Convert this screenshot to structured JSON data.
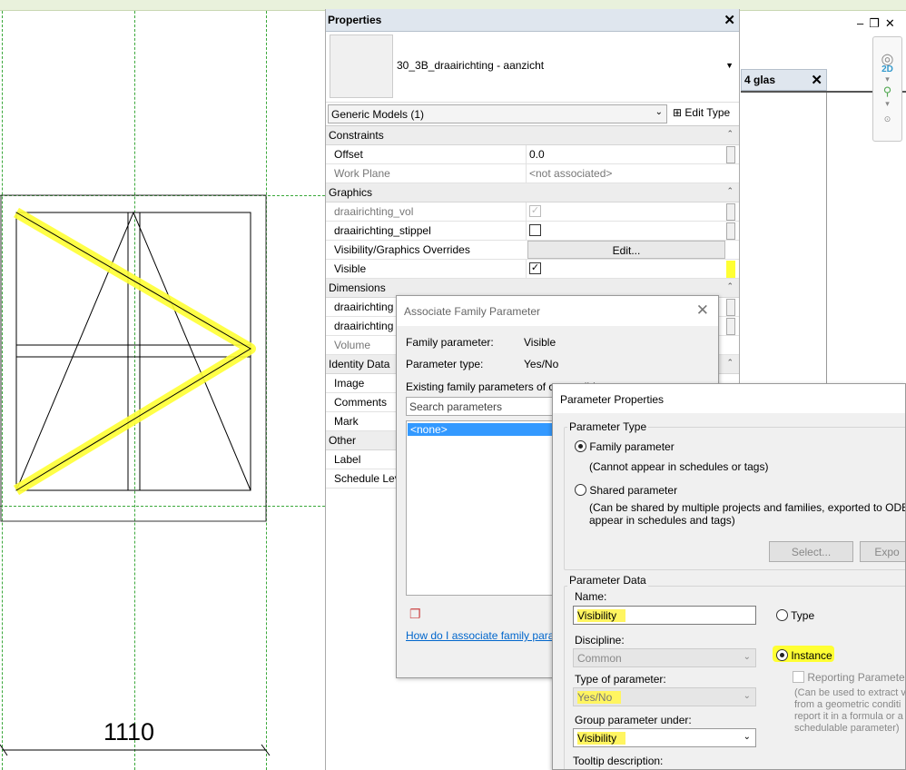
{
  "canvas": {
    "dimension": "1110"
  },
  "properties": {
    "title": "Properties",
    "family_name": "30_3B_draairichting - aanzicht",
    "selector": "Generic Models (1)",
    "edit_type": "Edit Type",
    "groups": {
      "constraints": "Constraints",
      "graphics": "Graphics",
      "dimensions": "Dimensions",
      "identity": "Identity Data",
      "other": "Other"
    },
    "rows": {
      "offset": {
        "name": "Offset",
        "value": "0.0"
      },
      "work_plane": {
        "name": "Work Plane",
        "value": "<not associated>"
      },
      "vol": {
        "name": "draairichting_vol"
      },
      "stippel": {
        "name": "draairichting_stippel"
      },
      "vg": {
        "name": "Visibility/Graphics Overrides",
        "value": "Edit..."
      },
      "visible": {
        "name": "Visible"
      },
      "dim1": {
        "name": "draairichting"
      },
      "dim2": {
        "name": "draairichting"
      },
      "volume": {
        "name": "Volume"
      },
      "image": {
        "name": "Image"
      },
      "comments": {
        "name": "Comments"
      },
      "mark": {
        "name": "Mark"
      },
      "label": {
        "name": "Label"
      },
      "schedule": {
        "name": "Schedule Lev"
      }
    }
  },
  "side_tab": {
    "label": "4 glas"
  },
  "assoc_dialog": {
    "title": "Associate Family Parameter",
    "family_parameter_label": "Family parameter:",
    "family_parameter_value": "Visible",
    "parameter_type_label": "Parameter type:",
    "parameter_type_value": "Yes/No",
    "existing_label": "Existing family parameters of compatible t",
    "search_placeholder": "Search parameters",
    "list_items": [
      "<none>"
    ],
    "help_link": "How do I associate family param"
  },
  "param_props": {
    "title": "Parameter Properties",
    "parameter_type_legend": "Parameter Type",
    "family_parameter": "Family parameter",
    "family_parameter_note": "(Cannot appear in schedules or tags)",
    "shared_parameter": "Shared parameter",
    "shared_note_1": "(Can be shared by multiple projects and families, exported to ODBC, an",
    "shared_note_2": "appear in schedules and tags)",
    "select_button": "Select...",
    "export_button": "Expo",
    "parameter_data_legend": "Parameter Data",
    "name_label": "Name:",
    "name_value": "Visibility",
    "type_radio": "Type",
    "discipline_label": "Discipline:",
    "discipline_value": "Common",
    "instance_radio": "Instance",
    "reporting_parameter": "Reporting Parameter",
    "reporting_note": [
      "(Can be used to extract v",
      "from a geometric conditi",
      "report it in a formula or a",
      "schedulable parameter)"
    ],
    "type_of_parameter_label": "Type of parameter:",
    "type_of_parameter_value": "Yes/No",
    "group_label": "Group parameter under:",
    "group_value": "Visibility",
    "tooltip_label": "Tooltip description:"
  },
  "colors": {
    "highlight": "#ffff33",
    "guide_green": "#3aa83a",
    "selection_blue": "#3399ff"
  }
}
